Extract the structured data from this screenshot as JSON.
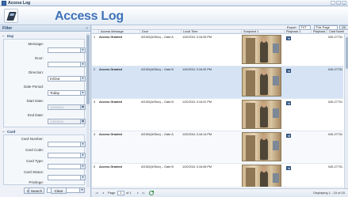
{
  "window": {
    "title": "Access Log",
    "controls": [
      "–",
      "□",
      "×"
    ]
  },
  "header": {
    "title": "Access Log"
  },
  "filters": {
    "heading": "Filter",
    "collapse": "«",
    "day": {
      "label": "Day",
      "message_label": "Message:",
      "door_label": "Door:",
      "direction_label": "Direction:",
      "direction_value": "In/Out",
      "date_period_label": "Date Period:",
      "date_period_value": "Today",
      "start_date_label": "Start Date:",
      "start_date_value": "1/20/2011",
      "end_date_label": "End Date:",
      "end_date_value": "1/20/2011"
    },
    "card": {
      "label": "Card",
      "card_number_label": "Card Number:",
      "card_code_label": "Card Code:",
      "card_type_label": "Card Type:",
      "card_status_label": "Card Status:",
      "privilege_label": "Privilege:"
    },
    "search_label": "Search",
    "clear_label": "Clear"
  },
  "grid": {
    "export_label": "Export",
    "export_format": "TXT",
    "export_scope": "This Page",
    "ok_label": "OK",
    "columns": [
      "Access Message",
      "Door",
      "Local Time",
      "Snapshot 1",
      "Playback 1",
      "Playback 2",
      "Card Number"
    ],
    "rows": [
      {
        "num": "1",
        "message": "Access Granted",
        "door": "AS100(AS5xx) – Gate A",
        "time": "1/20/2011 3:16:39 PM",
        "card": "045-27731"
      },
      {
        "num": "2",
        "message": "Access Granted",
        "door": "AS100(AS5xx) – Gate B",
        "time": "1/20/2011 3:16:32 PM",
        "card": "045-27731"
      },
      {
        "num": "3",
        "message": "Access Granted",
        "door": "AS100(AS5xx) – Gate B",
        "time": "1/20/2011 3:16:31 PM",
        "card": "045-27731"
      },
      {
        "num": "4",
        "message": "Access Granted",
        "door": "AS100(AS5xx) – Gate A",
        "time": "1/20/2011 3:16:14 PM",
        "card": "045-27731"
      },
      {
        "num": "5",
        "message": "Access Granted",
        "door": "AS100(AS5xx) – Gate B",
        "time": "1/20/2011 3:16:08 PM",
        "card": "045-27731"
      }
    ],
    "pager": {
      "page_label": "Page",
      "page_value": "1",
      "of_label": "of 1",
      "display_text": "Displaying 1 - 15 of 15"
    }
  }
}
